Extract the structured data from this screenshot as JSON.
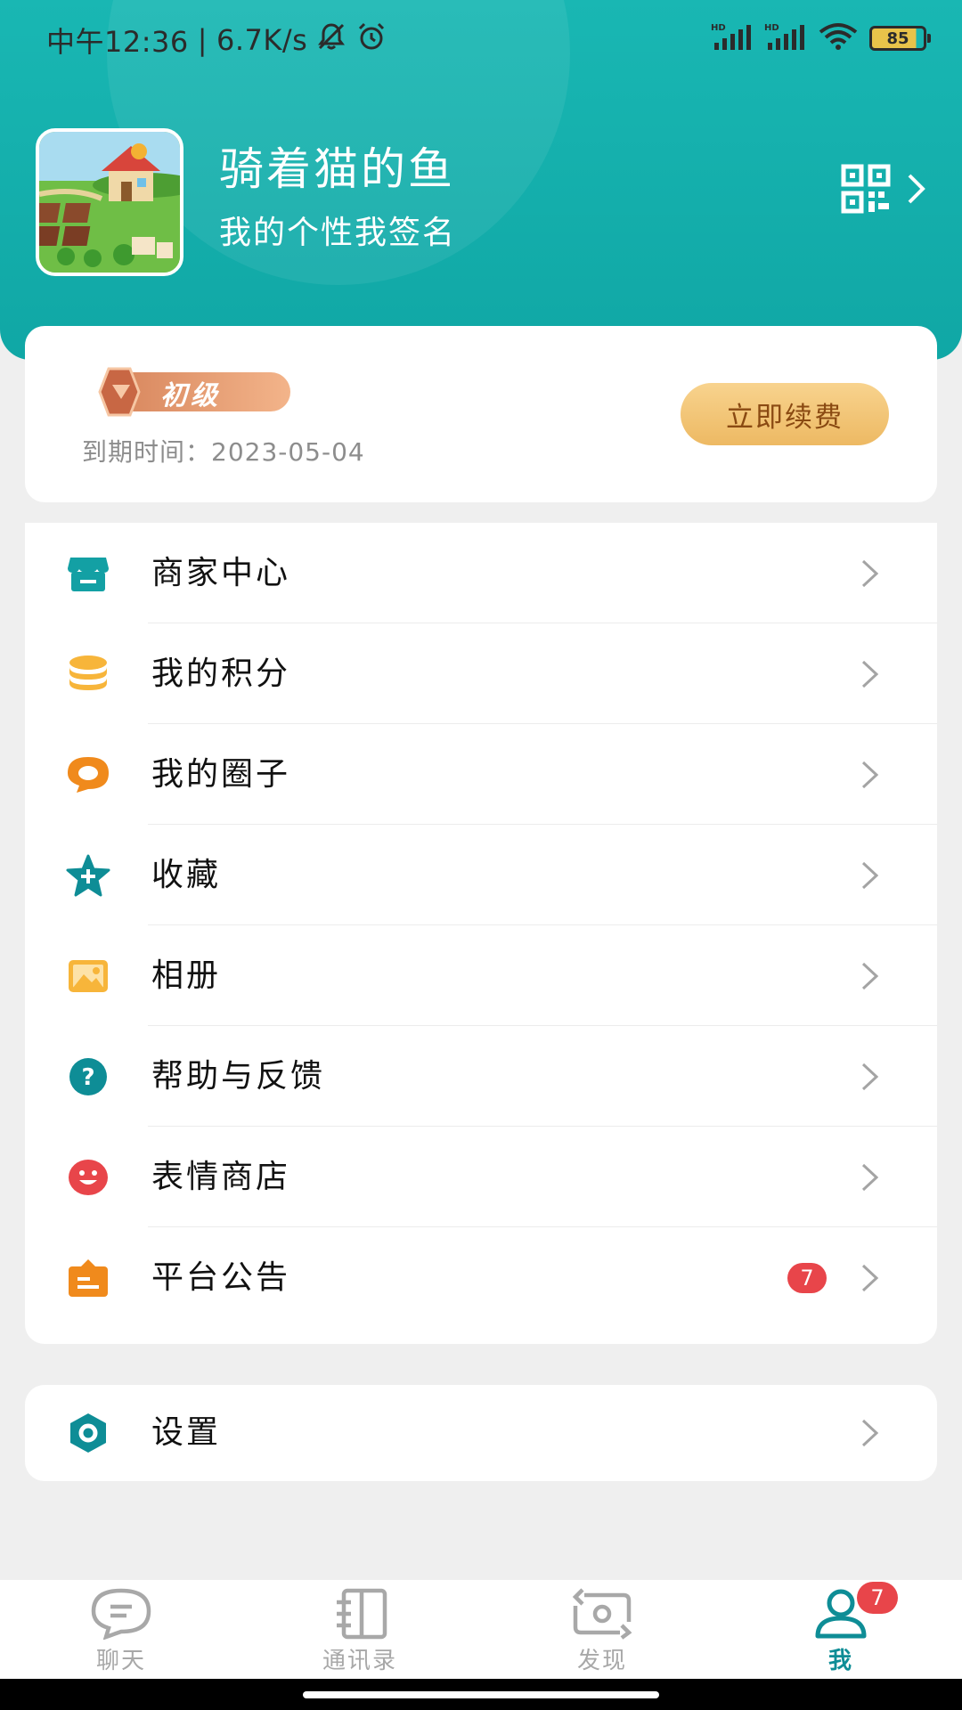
{
  "status_bar": {
    "time": "中午12:36",
    "network_speed": "6.7K/s",
    "battery_level": "85",
    "icons": [
      "mute-icon",
      "alarm-icon",
      "signal-hd-icon",
      "signal-hd-icon",
      "wifi-icon",
      "battery-icon"
    ]
  },
  "profile": {
    "name": "骑着猫的鱼",
    "signature": "我的个性我签名",
    "avatar_icon": "farm-game-avatar"
  },
  "vip": {
    "level_label": "初级",
    "expire_text": "到期时间：2023-05-04",
    "renew_label": "立即续费"
  },
  "menu": {
    "items": [
      {
        "label": "商家中心",
        "icon": "store-icon",
        "color": "#13a0a4"
      },
      {
        "label": "我的积分",
        "icon": "coins-icon",
        "color": "#f7b53a"
      },
      {
        "label": "我的圈子",
        "icon": "chat-bubble-icon",
        "color": "#f08a1c"
      },
      {
        "label": "收藏",
        "icon": "star-icon",
        "color": "#0e8d96"
      },
      {
        "label": "相册",
        "icon": "photo-icon",
        "color": "#f7b53a"
      },
      {
        "label": "帮助与反馈",
        "icon": "help-icon",
        "color": "#0e8d96"
      },
      {
        "label": "表情商店",
        "icon": "smile-icon",
        "color": "#e8454a"
      },
      {
        "label": "平台公告",
        "icon": "notice-icon",
        "color": "#f08a1c",
        "badge": "7"
      }
    ]
  },
  "settings": {
    "label": "设置",
    "icon": "settings-icon",
    "color": "#0e8d96"
  },
  "tabbar": {
    "tabs": [
      {
        "label": "聊天",
        "icon": "chat-icon"
      },
      {
        "label": "通讯录",
        "icon": "contacts-icon"
      },
      {
        "label": "发现",
        "icon": "discover-icon"
      },
      {
        "label": "我",
        "icon": "profile-icon",
        "badge": "7",
        "active": true
      }
    ]
  },
  "colors": {
    "brand": "#13a9a8",
    "accent_text": "#0e8d96",
    "badge": "#e8454a",
    "renew_button": "#f0bf6c"
  }
}
